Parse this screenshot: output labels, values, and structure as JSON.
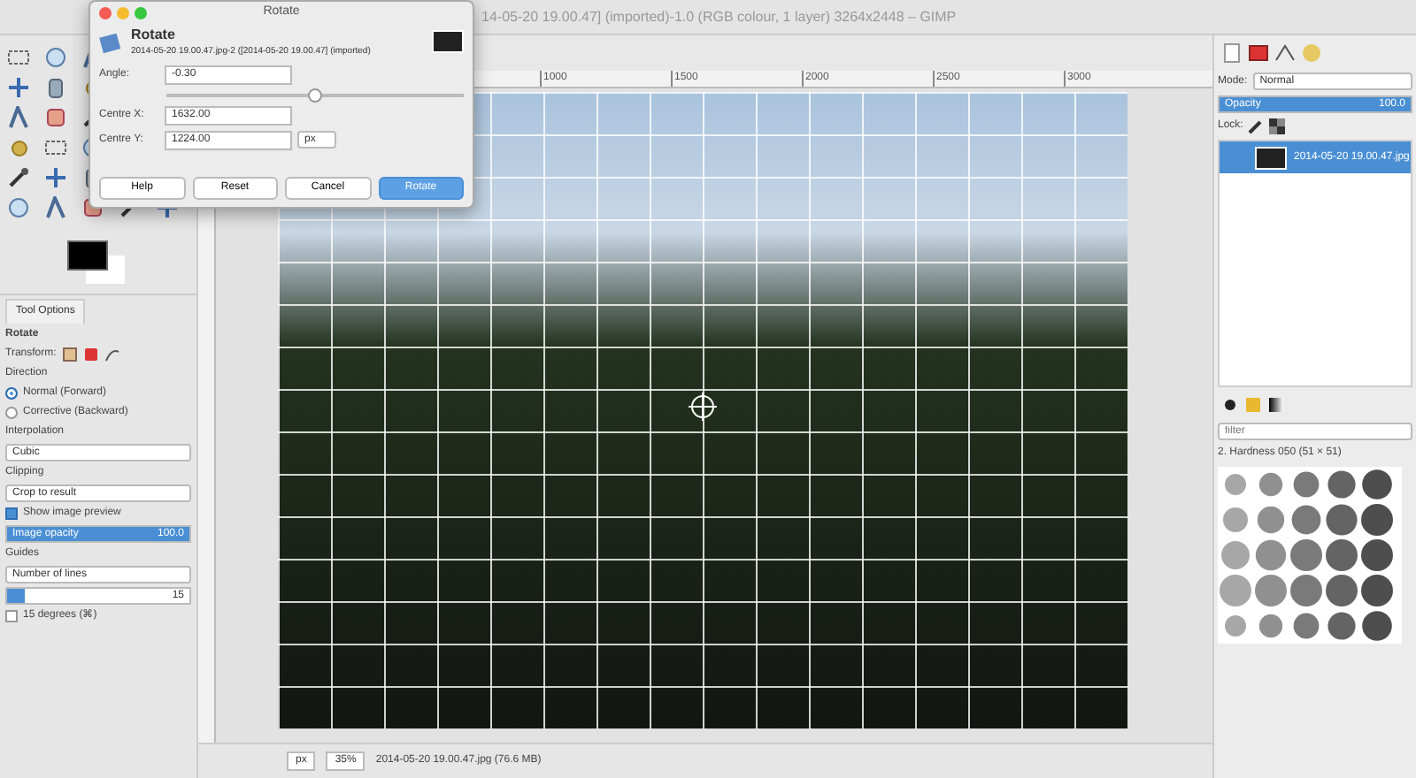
{
  "main_window": {
    "title": "14-05-20 19.00.47] (imported)-1.0 (RGB colour, 1 layer) 3264x2448 – GIMP"
  },
  "rotate_dialog": {
    "title": "Rotate",
    "heading": "Rotate",
    "subtitle": "2014-05-20 19.00.47.jpg-2 ([2014-05-20 19.00.47] (imported)",
    "angle": {
      "label": "Angle:",
      "value": "-0.30",
      "level": 0.5
    },
    "centre_x": {
      "label": "Centre X:",
      "value": "1632.00"
    },
    "centre_y": {
      "label": "Centre Y:",
      "value": "1224.00"
    },
    "unit": "px",
    "buttons": [
      {
        "label": "Help",
        "kind": "normal"
      },
      {
        "label": "Reset",
        "kind": "normal"
      },
      {
        "label": "Cancel",
        "kind": "normal"
      },
      {
        "label": "Rotate",
        "kind": "default"
      }
    ]
  },
  "tool_options": {
    "tab": "Tool Options",
    "tool": "Rotate",
    "transform_label": "Transform:",
    "direction_label": "Direction",
    "directions": [
      {
        "label": "Normal (Forward)",
        "selected": true
      },
      {
        "label": "Corrective (Backward)",
        "selected": false
      }
    ],
    "interpolation_label": "Interpolation",
    "interpolation": "Cubic",
    "clipping_label": "Clipping",
    "clipping": "Crop to result",
    "show_preview": {
      "label": "Show image preview",
      "checked": true
    },
    "opacity": {
      "label": "Image opacity",
      "value": "100.0",
      "level": 1
    },
    "guides_label": "Guides",
    "guides": "Number of lines",
    "lines": {
      "value": "15",
      "level": 0.1
    },
    "snap": {
      "label": "15 degrees (⌘)",
      "checked": false
    }
  },
  "canvas": {
    "ruler_marks": [
      "1000",
      "1500",
      "2000",
      "2500",
      "3000"
    ]
  },
  "status_bar": {
    "unit": "px",
    "zoom": "35%",
    "info": "2014-05-20 19.00.47.jpg (76.6 MB)"
  },
  "layers": {
    "mode_label": "Mode:",
    "mode": "Normal",
    "opacity": {
      "label": "Opacity",
      "value": "100.0",
      "level": 1
    },
    "lock_label": "Lock:",
    "items": [
      {
        "name": "2014-05-20 19.00.47.jpg",
        "selected": true
      }
    ]
  },
  "brushes": {
    "filter_placeholder": "filter",
    "brush_name": "2. Hardness 050 (51 × 51)"
  }
}
